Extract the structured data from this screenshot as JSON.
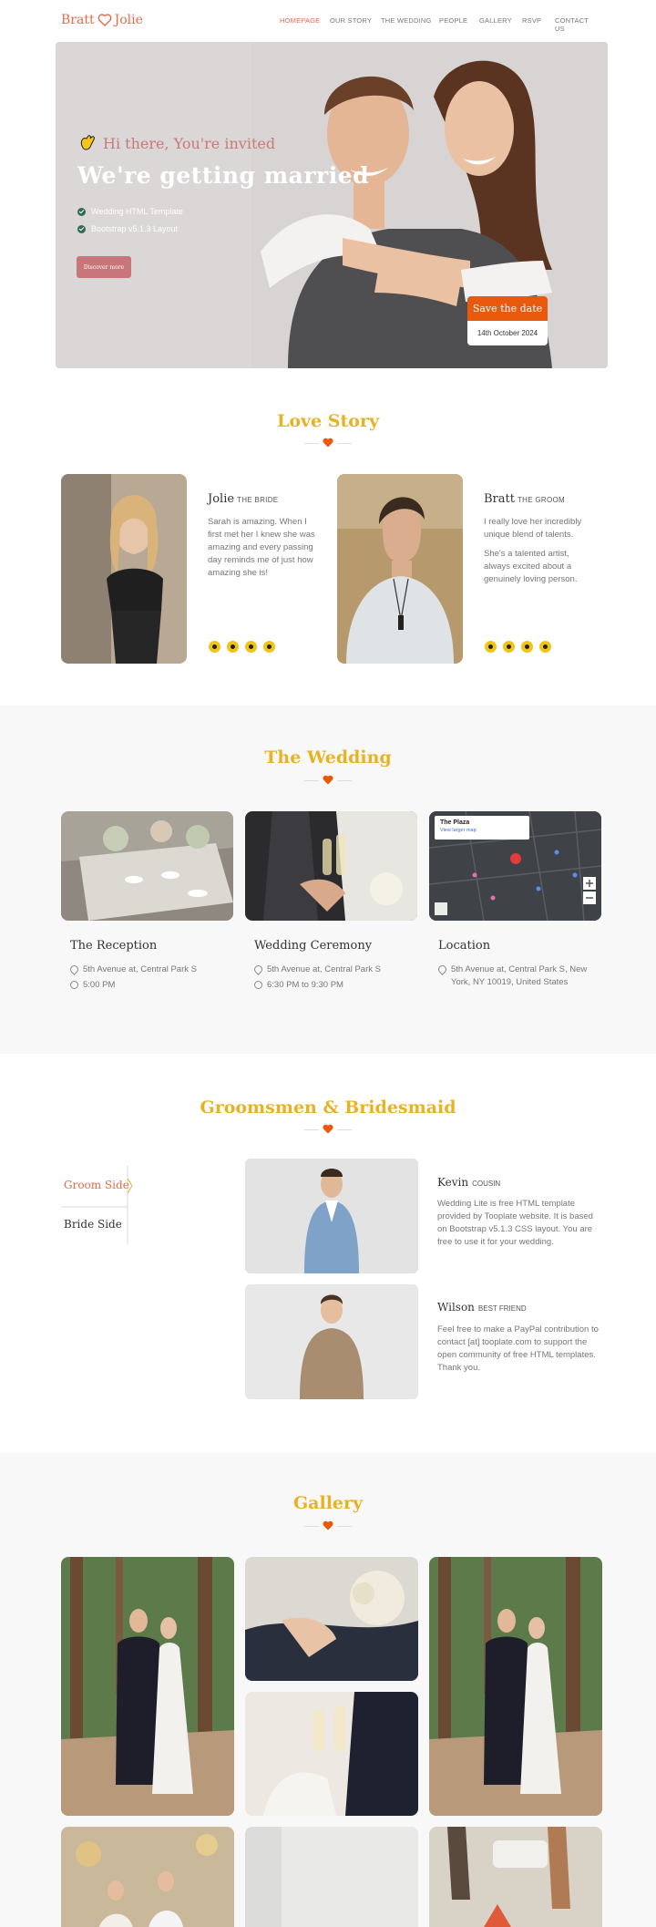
{
  "header": {
    "brand_left": "Bratt",
    "brand_right": "Jolie",
    "nav": [
      "HOMEPAGE",
      "OUR STORY",
      "THE WEDDING",
      "PEOPLE",
      "GALLERY",
      "RSVP",
      "CONTACT US"
    ]
  },
  "hero": {
    "greeting": "Hi there, You're invited",
    "title": "We're getting married",
    "features": [
      "Wedding HTML Template",
      "Bootstrap v5.1.3 Layout"
    ],
    "cta": "Discover more",
    "save_label": "Save the date",
    "save_date": "14th October 2024"
  },
  "love_story": {
    "title": "Love Story",
    "bride": {
      "name": "Jolie",
      "role": "THE BRIDE",
      "text": "Sarah is amazing. When I first met her I knew she was amazing and every passing day reminds me of just how amazing she is!"
    },
    "groom": {
      "name": "Bratt",
      "role": "THE GROOM",
      "text1": "I really love her incredibly unique blend of talents.",
      "text2": "She's a talented artist, always excited about a genuinely loving person."
    }
  },
  "wedding": {
    "title": "The Wedding",
    "reception": {
      "title": "The Reception",
      "address": "5th Avenue at, Central Park S",
      "time": "5:00 PM"
    },
    "ceremony": {
      "title": "Wedding Ceremony",
      "address": "5th Avenue at, Central Park S",
      "time": "6:30 PM to 9:30 PM"
    },
    "location": {
      "title": "Location",
      "address": "5th Avenue at, Central Park S, New York, NY 10019, United States"
    },
    "map": {
      "place": "The Plaza",
      "link": "View larger map"
    }
  },
  "people": {
    "title": "Groomsmen & Bridesmaid",
    "tabs": [
      "Groom Side",
      "Bride Side"
    ],
    "members": [
      {
        "name": "Kevin",
        "role": "COUSIN",
        "text": "Wedding Lite is free HTML template provided by Tooplate website. It is based on Bootstrap v5.1.3 CSS layout. You are free to use it for your wedding."
      },
      {
        "name": "Wilson",
        "role": "BEST FRIEND",
        "text": "Feel free to make a PayPal contribution to contact [at] tooplate.com to support the open community of free HTML templates. Thank you."
      }
    ]
  },
  "gallery": {
    "title": "Gallery"
  },
  "colors": {
    "accent": "#e76a48",
    "gold": "#e8b323",
    "heart": "#e8590c"
  }
}
